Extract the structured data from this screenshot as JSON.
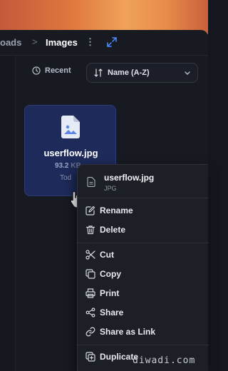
{
  "breadcrumb": {
    "previous": "oads",
    "separator": ">",
    "current": "Images"
  },
  "toolbar": {
    "more_glyph": "⋮",
    "recent_label": "Recent",
    "sort_label": "Name (A-Z)"
  },
  "file": {
    "name": "userflow.jpg",
    "size": "93.2",
    "size_tail": "KB",
    "date": "Tod"
  },
  "context_menu": {
    "header_title": "userflow.jpg",
    "header_subtitle": "JPG",
    "items": [
      {
        "label": "Rename",
        "icon": "edit-icon"
      },
      {
        "label": "Delete",
        "icon": "trash-icon"
      },
      {
        "label": "Cut",
        "icon": "scissors-icon"
      },
      {
        "label": "Copy",
        "icon": "copy-icon"
      },
      {
        "label": "Print",
        "icon": "printer-icon"
      },
      {
        "label": "Share",
        "icon": "share-icon"
      },
      {
        "label": "Share as Link",
        "icon": "link-icon"
      },
      {
        "label": "Duplicate",
        "icon": "duplicate-icon"
      }
    ]
  },
  "watermark": "diwadi.com",
  "colors": {
    "selection": "#1e2a5a",
    "accent": "#4f8cff",
    "menu_bg": "#1d1f27",
    "window_bg": "#181a22"
  }
}
